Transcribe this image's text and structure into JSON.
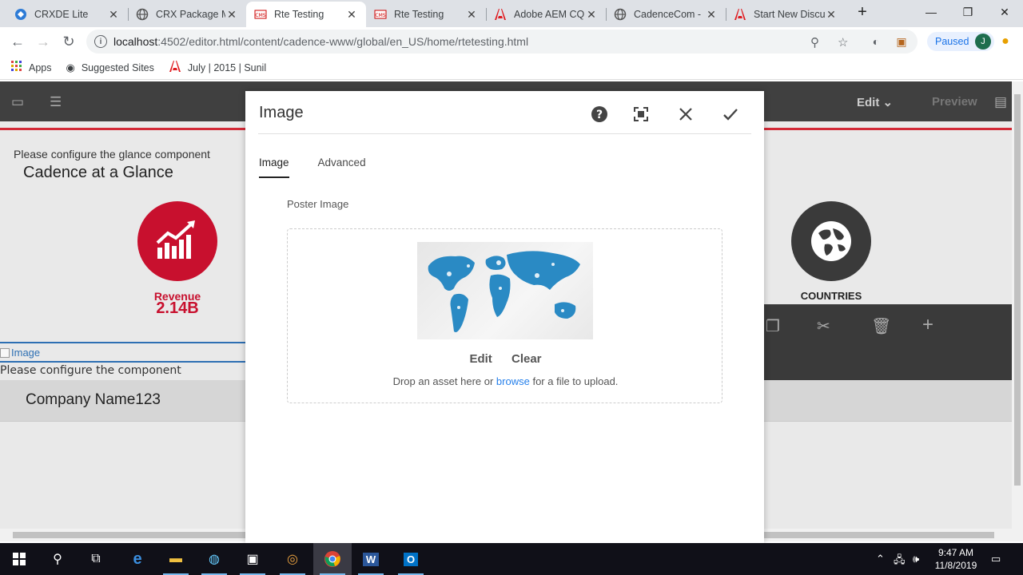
{
  "browser": {
    "tabs": [
      {
        "title": "CRXDE Lite",
        "icon": "crxde-icon"
      },
      {
        "title": "CRX Package Ma",
        "icon": "globe-icon"
      },
      {
        "title": "Rte Testing",
        "icon": "cms-icon"
      },
      {
        "title": "Rte Testing",
        "icon": "cms-icon"
      },
      {
        "title": "Adobe AEM CQ",
        "icon": "adobe-icon"
      },
      {
        "title": "CadenceCom - ",
        "icon": "globe-icon"
      },
      {
        "title": "Start New Discu",
        "icon": "adobe-icon"
      }
    ],
    "url_host": "localhost",
    "url_path": ":4502/editor.html/content/cadence-www/global/en_US/home/rtetesting.html",
    "profile_status": "Paused",
    "profile_initial": "J",
    "bookmarks": [
      {
        "label": "Apps",
        "icon": "apps-grid-icon"
      },
      {
        "label": "Suggested Sites",
        "icon": "globe-icon"
      },
      {
        "label": "July | 2015 | Sunil",
        "icon": "adobe-icon"
      }
    ]
  },
  "editor": {
    "mode_label": "Edit",
    "preview_label": "Preview"
  },
  "page": {
    "glance_hint": "Please configure the glance component",
    "glance_title": "Cadence at a Glance",
    "revenue_label": "Revenue",
    "revenue_value": "2.14B",
    "countries_label": "COUNTRIES",
    "image_alt": "Image",
    "component_hint": "Please configure the component",
    "company_name": "Company Name123"
  },
  "dialog": {
    "title": "Image",
    "tabs": [
      "Image",
      "Advanced"
    ],
    "active_tab": "Image",
    "field_label": "Poster Image",
    "edit_label": "Edit",
    "clear_label": "Clear",
    "hint_before": "Drop an asset here or ",
    "hint_link": "browse",
    "hint_after": " for a file to upload."
  },
  "taskbar": {
    "time": "9:47 AM",
    "date": "11/8/2019"
  },
  "colors": {
    "accent_red": "#c8102e",
    "link_blue": "#2680eb",
    "editor_dark": "#404040"
  }
}
